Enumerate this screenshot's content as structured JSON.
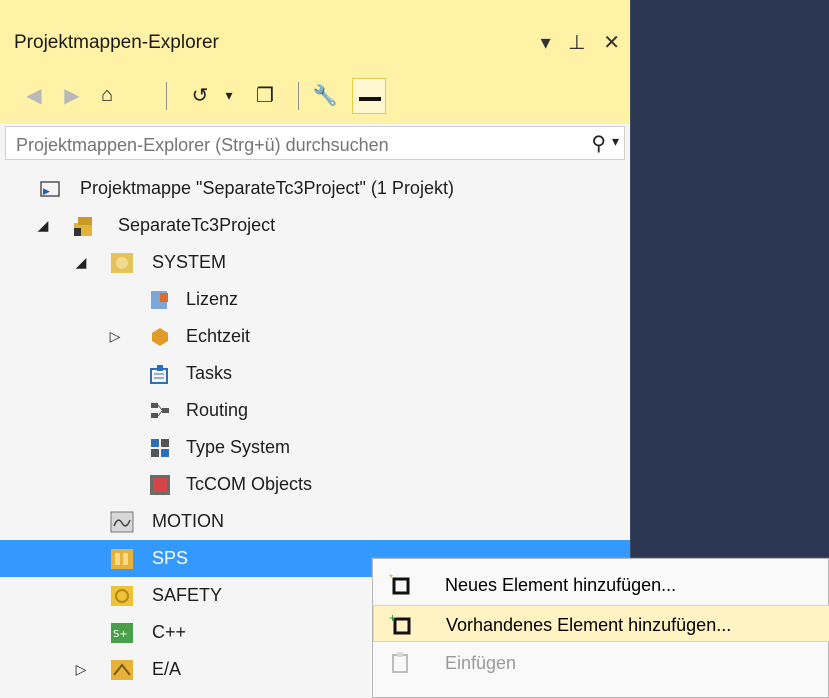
{
  "panel": {
    "title": "Projektmappen-Explorer",
    "title_icons": [
      "dropdown-arrow-icon",
      "pin-icon",
      "close-icon"
    ]
  },
  "toolbar": {
    "items": [
      "back-icon",
      "forward-icon",
      "home-icon",
      "history-icon",
      "dropdown-icon",
      "copy-window-icon",
      "wrench-icon",
      "pin-bar-icon"
    ]
  },
  "search": {
    "placeholder": "Projektmappen-Explorer (Strg+ü) durchsuchen"
  },
  "tree": {
    "solution_label": "Projektmappe \"SeparateTc3Project\" (1 Projekt)",
    "project_label": "SeparateTc3Project",
    "system_label": "SYSTEM",
    "lizenz_label": "Lizenz",
    "echtzeit_label": "Echtzeit",
    "tasks_label": "Tasks",
    "routing_label": "Routing",
    "type_system_label": "Type System",
    "tccom_label": "TcCOM Objects",
    "motion_label": "MOTION",
    "sps_label": "SPS",
    "safety_label": "SAFETY",
    "cpp_label": "C++",
    "ea_label": "E/A"
  },
  "context_menu": {
    "items": [
      {
        "label": "Neues Element hinzufügen...",
        "state": "normal"
      },
      {
        "label": "Vorhandenes Element hinzufügen...",
        "state": "hover"
      },
      {
        "label": "Einfügen",
        "state": "disabled"
      }
    ]
  },
  "colors": {
    "accent": "#3399ff",
    "panel_header": "#fff1a6",
    "background_dark": "#2a3652"
  }
}
